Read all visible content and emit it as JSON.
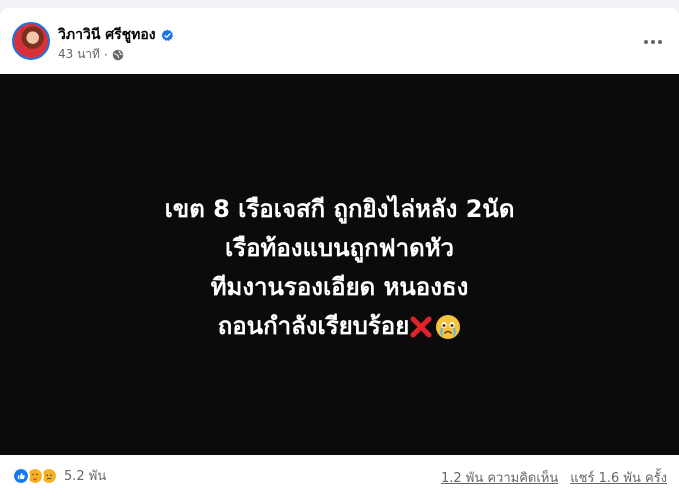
{
  "post": {
    "author": "วิภาวินี ศรีชูทอง",
    "time": "43 นาที",
    "image_text": {
      "line1": "เขต 8 เรือเจสกี ถูกยิงไล่หลัง 2นัด",
      "line2": "เรือท้องแบนถูกฟาดหัว",
      "line3": "ทีมงานรองเอียด หนองธง",
      "line4": "ถอนกำลังเรียบร้อย"
    },
    "reaction_count": "5.2 พัน",
    "comments": "1.2 พัน ความคิดเห็น",
    "shares": "แชร์ 1.6 พัน ครั้ง"
  },
  "colors": {
    "accent": "#1b74e4",
    "like": "#1877f2",
    "heart": "#f33e58",
    "care": "#f7b125",
    "image_bg": "#0b0b0b",
    "meta": "#65676b"
  },
  "icons": [
    "avatar",
    "verified-badge-icon",
    "globe-icon",
    "more-options-icon",
    "cross-mark-emoji",
    "crying-face-emoji",
    "like-reaction-icon",
    "care-reaction-icon",
    "sad-reaction-icon"
  ]
}
